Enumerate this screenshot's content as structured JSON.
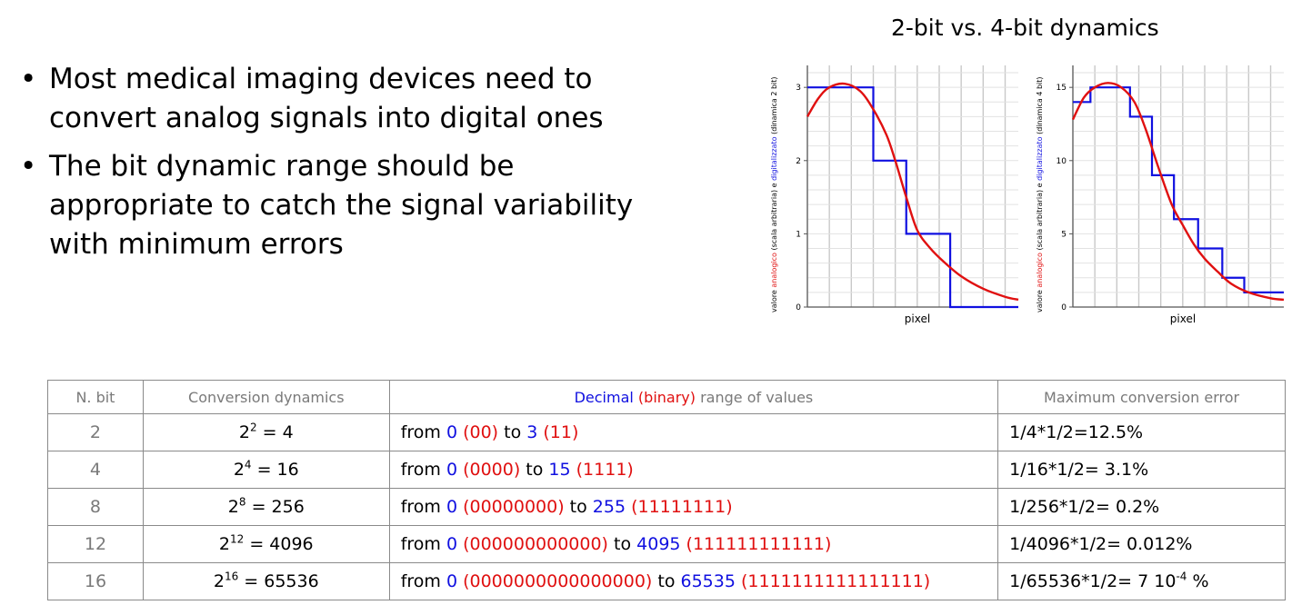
{
  "bullets": [
    "Most medical imaging devices need to convert analog signals into digital ones",
    "The bit dynamic range should be appropriate to catch the signal variability with minimum errors"
  ],
  "figure_title": "2-bit vs. 4-bit dynamics",
  "colors": {
    "analog": "#e01010",
    "digital": "#1010e0",
    "grid": "#c8c8c8"
  },
  "chart_data": [
    {
      "type": "line",
      "xlabel": "pixel",
      "ylabel_parts": [
        "valore ",
        "analogico",
        " (scala arbitraria) e ",
        "digitalizzato",
        " (dinamica 2 bit)"
      ],
      "yticks": [
        0,
        1,
        2,
        3
      ],
      "ylim": [
        0,
        3.3
      ],
      "xlim": [
        0,
        9.6
      ],
      "series": [
        {
          "points": [
            [
              0,
              2.6
            ],
            [
              0.5,
              2.85
            ],
            [
              1,
              3.0
            ],
            [
              1.7,
              3.05
            ],
            [
              2.4,
              2.95
            ],
            [
              3,
              2.7
            ],
            [
              3.6,
              2.35
            ],
            [
              4,
              2.0
            ],
            [
              4.5,
              1.5
            ],
            [
              5,
              1.05
            ],
            [
              5.6,
              0.8
            ],
            [
              6.2,
              0.62
            ],
            [
              7,
              0.42
            ],
            [
              8,
              0.25
            ],
            [
              9,
              0.14
            ],
            [
              9.6,
              0.1
            ]
          ]
        },
        {
          "steps": [
            [
              0,
              3
            ],
            [
              3,
              3
            ],
            [
              3,
              2
            ],
            [
              4.5,
              2
            ],
            [
              4.5,
              1
            ],
            [
              6.5,
              1
            ],
            [
              6.5,
              0
            ],
            [
              9.6,
              0
            ]
          ]
        }
      ]
    },
    {
      "type": "line",
      "xlabel": "pixel",
      "ylabel_parts": [
        "valore ",
        "analogico",
        " (scala arbitraria) e ",
        "digitalizzato",
        " (dinamica 4 bit)"
      ],
      "yticks": [
        0,
        5,
        10,
        15
      ],
      "ylim": [
        0,
        16.5
      ],
      "xlim": [
        0,
        9.6
      ],
      "series": [
        {
          "points": [
            [
              0,
              12.8
            ],
            [
              0.5,
              14.3
            ],
            [
              1,
              15.0
            ],
            [
              1.6,
              15.3
            ],
            [
              2.2,
              15.0
            ],
            [
              2.8,
              14.0
            ],
            [
              3.3,
              12.2
            ],
            [
              3.9,
              9.5
            ],
            [
              4.5,
              7.0
            ],
            [
              5,
              5.6
            ],
            [
              5.5,
              4.3
            ],
            [
              6,
              3.3
            ],
            [
              6.6,
              2.4
            ],
            [
              7.2,
              1.6
            ],
            [
              8,
              1.0
            ],
            [
              9,
              0.6
            ],
            [
              9.6,
              0.5
            ]
          ]
        },
        {
          "steps": [
            [
              0,
              14
            ],
            [
              0.8,
              14
            ],
            [
              0.8,
              15
            ],
            [
              2.6,
              15
            ],
            [
              2.6,
              13
            ],
            [
              3.6,
              13
            ],
            [
              3.6,
              9
            ],
            [
              4.6,
              9
            ],
            [
              4.6,
              6
            ],
            [
              5.7,
              6
            ],
            [
              5.7,
              4
            ],
            [
              6.8,
              4
            ],
            [
              6.8,
              2
            ],
            [
              7.8,
              2
            ],
            [
              7.8,
              1
            ],
            [
              9.6,
              1
            ]
          ]
        }
      ]
    }
  ],
  "table": {
    "headers": {
      "nbit": "N. bit",
      "dyn": "Conversion dynamics",
      "range_parts": [
        "Decimal",
        " (binary)",
        " range of values"
      ],
      "err": "Maximum conversion error"
    },
    "rows": [
      {
        "nbit": "2",
        "base": "2",
        "exp": "2",
        "result": " = 4",
        "from": "from ",
        "min": "0",
        "min_bin": " (00)",
        "to": " to ",
        "max": "3",
        "max_bin": " (11)",
        "err": "1/4*1/2=12.5%",
        "err_exp": "",
        "err_tail": ""
      },
      {
        "nbit": "4",
        "base": "2",
        "exp": "4",
        "result": " = 16",
        "from": "from ",
        "min": "0",
        "min_bin": " (0000)",
        "to": " to ",
        "max": "15",
        "max_bin": " (1111)",
        "err": "1/16*1/2=  3.1%",
        "err_exp": "",
        "err_tail": ""
      },
      {
        "nbit": "8",
        "base": "2",
        "exp": "8",
        "result": " = 256",
        "from": "from ",
        "min": "0",
        "min_bin": " (00000000)",
        "to": " to ",
        "max": "255",
        "max_bin": " (11111111)",
        "err": "1/256*1/2=  0.2%",
        "err_exp": "",
        "err_tail": ""
      },
      {
        "nbit": "12",
        "base": "2",
        "exp": "12",
        "result": " = 4096",
        "from": "from ",
        "min": "0",
        "min_bin": " (000000000000)",
        "to": " to ",
        "max": "4095",
        "max_bin": " (111111111111)",
        "err": "1/4096*1/2=  0.012%",
        "err_exp": "",
        "err_tail": ""
      },
      {
        "nbit": "16",
        "base": "2",
        "exp": "16",
        "result": " = 65536",
        "from": "from ",
        "min": "0",
        "min_bin": " (0000000000000000)",
        "to": " to ",
        "max": "65535",
        "max_bin": " (1111111111111111)",
        "err": "1/65536*1/2=  7 10",
        "err_exp": "-4",
        "err_tail": " %"
      }
    ]
  }
}
